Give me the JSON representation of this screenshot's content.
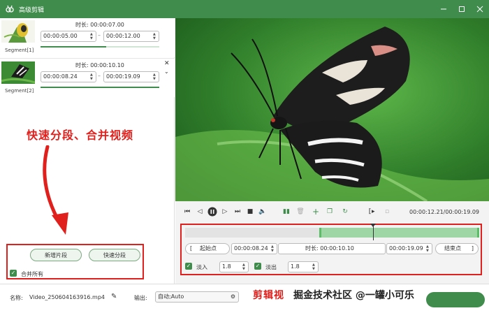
{
  "window": {
    "title": "高级剪辑"
  },
  "segments": [
    {
      "label": "Segment[1]",
      "duration_label": "时长: 00:00:07.00",
      "start": "00:00:05.00",
      "end": "00:00:12.00",
      "progress": 0.55
    },
    {
      "label": "Segment[2]",
      "duration_label": "时长: 00:00:10.10",
      "start": "00:00:08.24",
      "end": "00:00:19.09",
      "progress": 1.0
    }
  ],
  "annotation": {
    "text": "快速分段、合并视频"
  },
  "actions": {
    "add_segment": "新增片段",
    "quick_split": "快速分段",
    "merge_all": "合并所有"
  },
  "player": {
    "timecode": "00:00:12.21/00:00:19.09"
  },
  "timeline": {
    "selection_start": 0.455,
    "selection_end": 1.0,
    "playhead": 0.64,
    "start_point_label": "起始点",
    "start_value": "00:00:08.24",
    "duration_label": "时长: 00:00:10.10",
    "end_value": "00:00:19.09",
    "end_point_label": "结束点",
    "fade_in_label": "淡入",
    "fade_in_value": "1.8",
    "fade_out_label": "淡出",
    "fade_out_value": "1.8"
  },
  "footer": {
    "name_label": "名称:",
    "name_value": "Video_250604163916.mp4",
    "output_label": "输出:",
    "output_value": "自动;Auto",
    "watermark_red": "剪辑视",
    "watermark_dark": "掘金技术社区 @一罐小可乐"
  },
  "colors": {
    "accent": "#3f8c4c",
    "annotation_red": "#e0201c"
  }
}
